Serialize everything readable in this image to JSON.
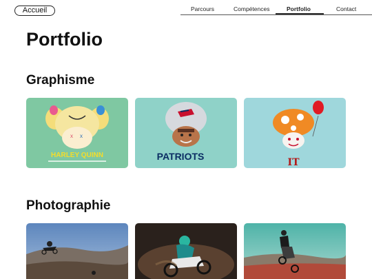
{
  "nav": {
    "home_label": "Accueil",
    "items": [
      {
        "label": "Parcours"
      },
      {
        "label": "Compétences"
      },
      {
        "label": "Portfolio",
        "active": true
      },
      {
        "label": "Contact"
      }
    ]
  },
  "page": {
    "title": "Portfolio"
  },
  "sections": {
    "graphisme": {
      "title": "Graphisme",
      "items": [
        {
          "name": "Harley Quinn mushroom",
          "caption": "HARLEY QUINN",
          "bg": "#7fc8a2"
        },
        {
          "name": "Patriots mushroom",
          "caption": "PATRIOTS",
          "bg": "#8fd2c8"
        },
        {
          "name": "IT mushroom",
          "caption": "IT",
          "bg": "#9fd7dc"
        }
      ]
    },
    "photographie": {
      "title": "Photographie",
      "items": [
        {
          "name": "motocross jump 1"
        },
        {
          "name": "motocross rider 2"
        },
        {
          "name": "motocross jump 3"
        }
      ]
    }
  }
}
